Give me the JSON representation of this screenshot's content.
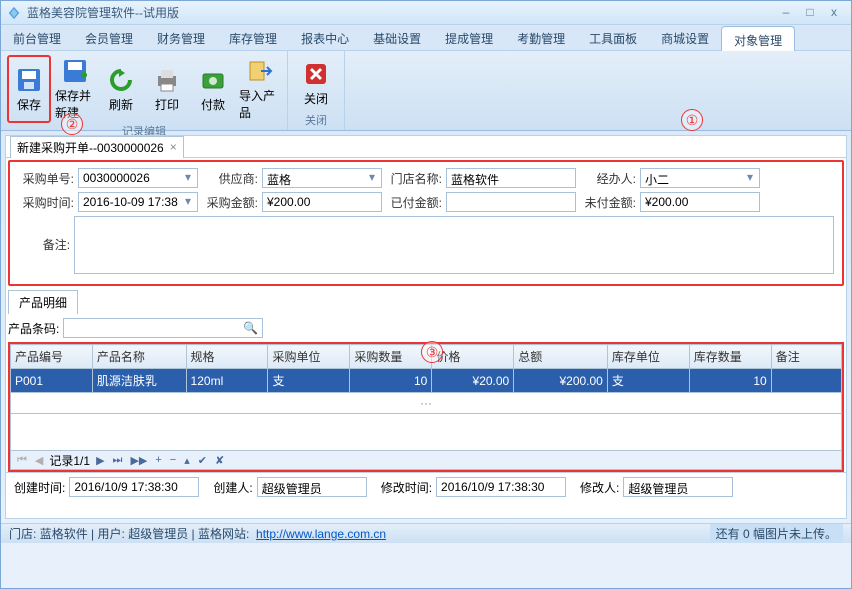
{
  "window": {
    "title": "蓝格美容院管理软件--试用版"
  },
  "menus": [
    "前台管理",
    "会员管理",
    "财务管理",
    "库存管理",
    "报表中心",
    "基础设置",
    "提成管理",
    "考勤管理",
    "工具面板",
    "商城设置",
    "对象管理"
  ],
  "menu_active_index": 10,
  "ribbon": {
    "group1_label": "记录编辑",
    "group2_label": "关闭",
    "items1": [
      {
        "label": "保存",
        "icon": "save"
      },
      {
        "label": "保存并新建",
        "icon": "savenew"
      },
      {
        "label": "刷新",
        "icon": "refresh"
      },
      {
        "label": "打印",
        "icon": "print"
      },
      {
        "label": "付款",
        "icon": "pay"
      },
      {
        "label": "导入产品",
        "icon": "import"
      }
    ],
    "items2": [
      {
        "label": "关闭",
        "icon": "close"
      }
    ]
  },
  "doctab": {
    "label": "新建采购开单--0030000026"
  },
  "form": {
    "order_no_label": "采购单号:",
    "order_no": "0030000026",
    "supplier_label": "供应商:",
    "supplier": "蓝格",
    "store_label": "门店名称:",
    "store": "蓝格软件",
    "agent_label": "经办人:",
    "agent": "小二",
    "time_label": "采购时间:",
    "time": "2016-10-09 17:38",
    "amount_label": "采购金额:",
    "amount": "¥200.00",
    "paid_label": "已付金额:",
    "paid": "",
    "unpaid_label": "未付金额:",
    "unpaid": "¥200.00",
    "remark_label": "备注:",
    "remark": ""
  },
  "sub_tab": "产品明细",
  "barcode_label": "产品条码:",
  "barcode": "",
  "grid": {
    "headers": [
      "产品编号",
      "产品名称",
      "规格",
      "采购单位",
      "采购数量",
      "价格",
      "总额",
      "库存单位",
      "库存数量",
      "备注"
    ],
    "row": {
      "code": "P001",
      "name": "肌源洁肤乳",
      "spec": "120ml",
      "unit": "支",
      "qty": "10",
      "price": "¥20.00",
      "total": "¥200.00",
      "stock_unit": "支",
      "stock_qty": "10",
      "remark": ""
    }
  },
  "nav": {
    "pos": "记录1/1"
  },
  "meta": {
    "create_time_label": "创建时间:",
    "create_time": "2016/10/9 17:38:30",
    "creator_label": "创建人:",
    "creator": "超级管理员",
    "modify_time_label": "修改时间:",
    "modify_time": "2016/10/9 17:38:30",
    "modifier_label": "修改人:",
    "modifier": "超级管理员"
  },
  "status": {
    "store_label": "门店:",
    "store": "蓝格软件",
    "user_label": "用户:",
    "user": "超级管理员",
    "site_label": "蓝格网站:",
    "site_url": "http://www.lange.com.cn",
    "right": "还有 0 幅图片未上传。"
  },
  "annotations": {
    "a1": "①",
    "a2": "②",
    "a3": "③"
  }
}
